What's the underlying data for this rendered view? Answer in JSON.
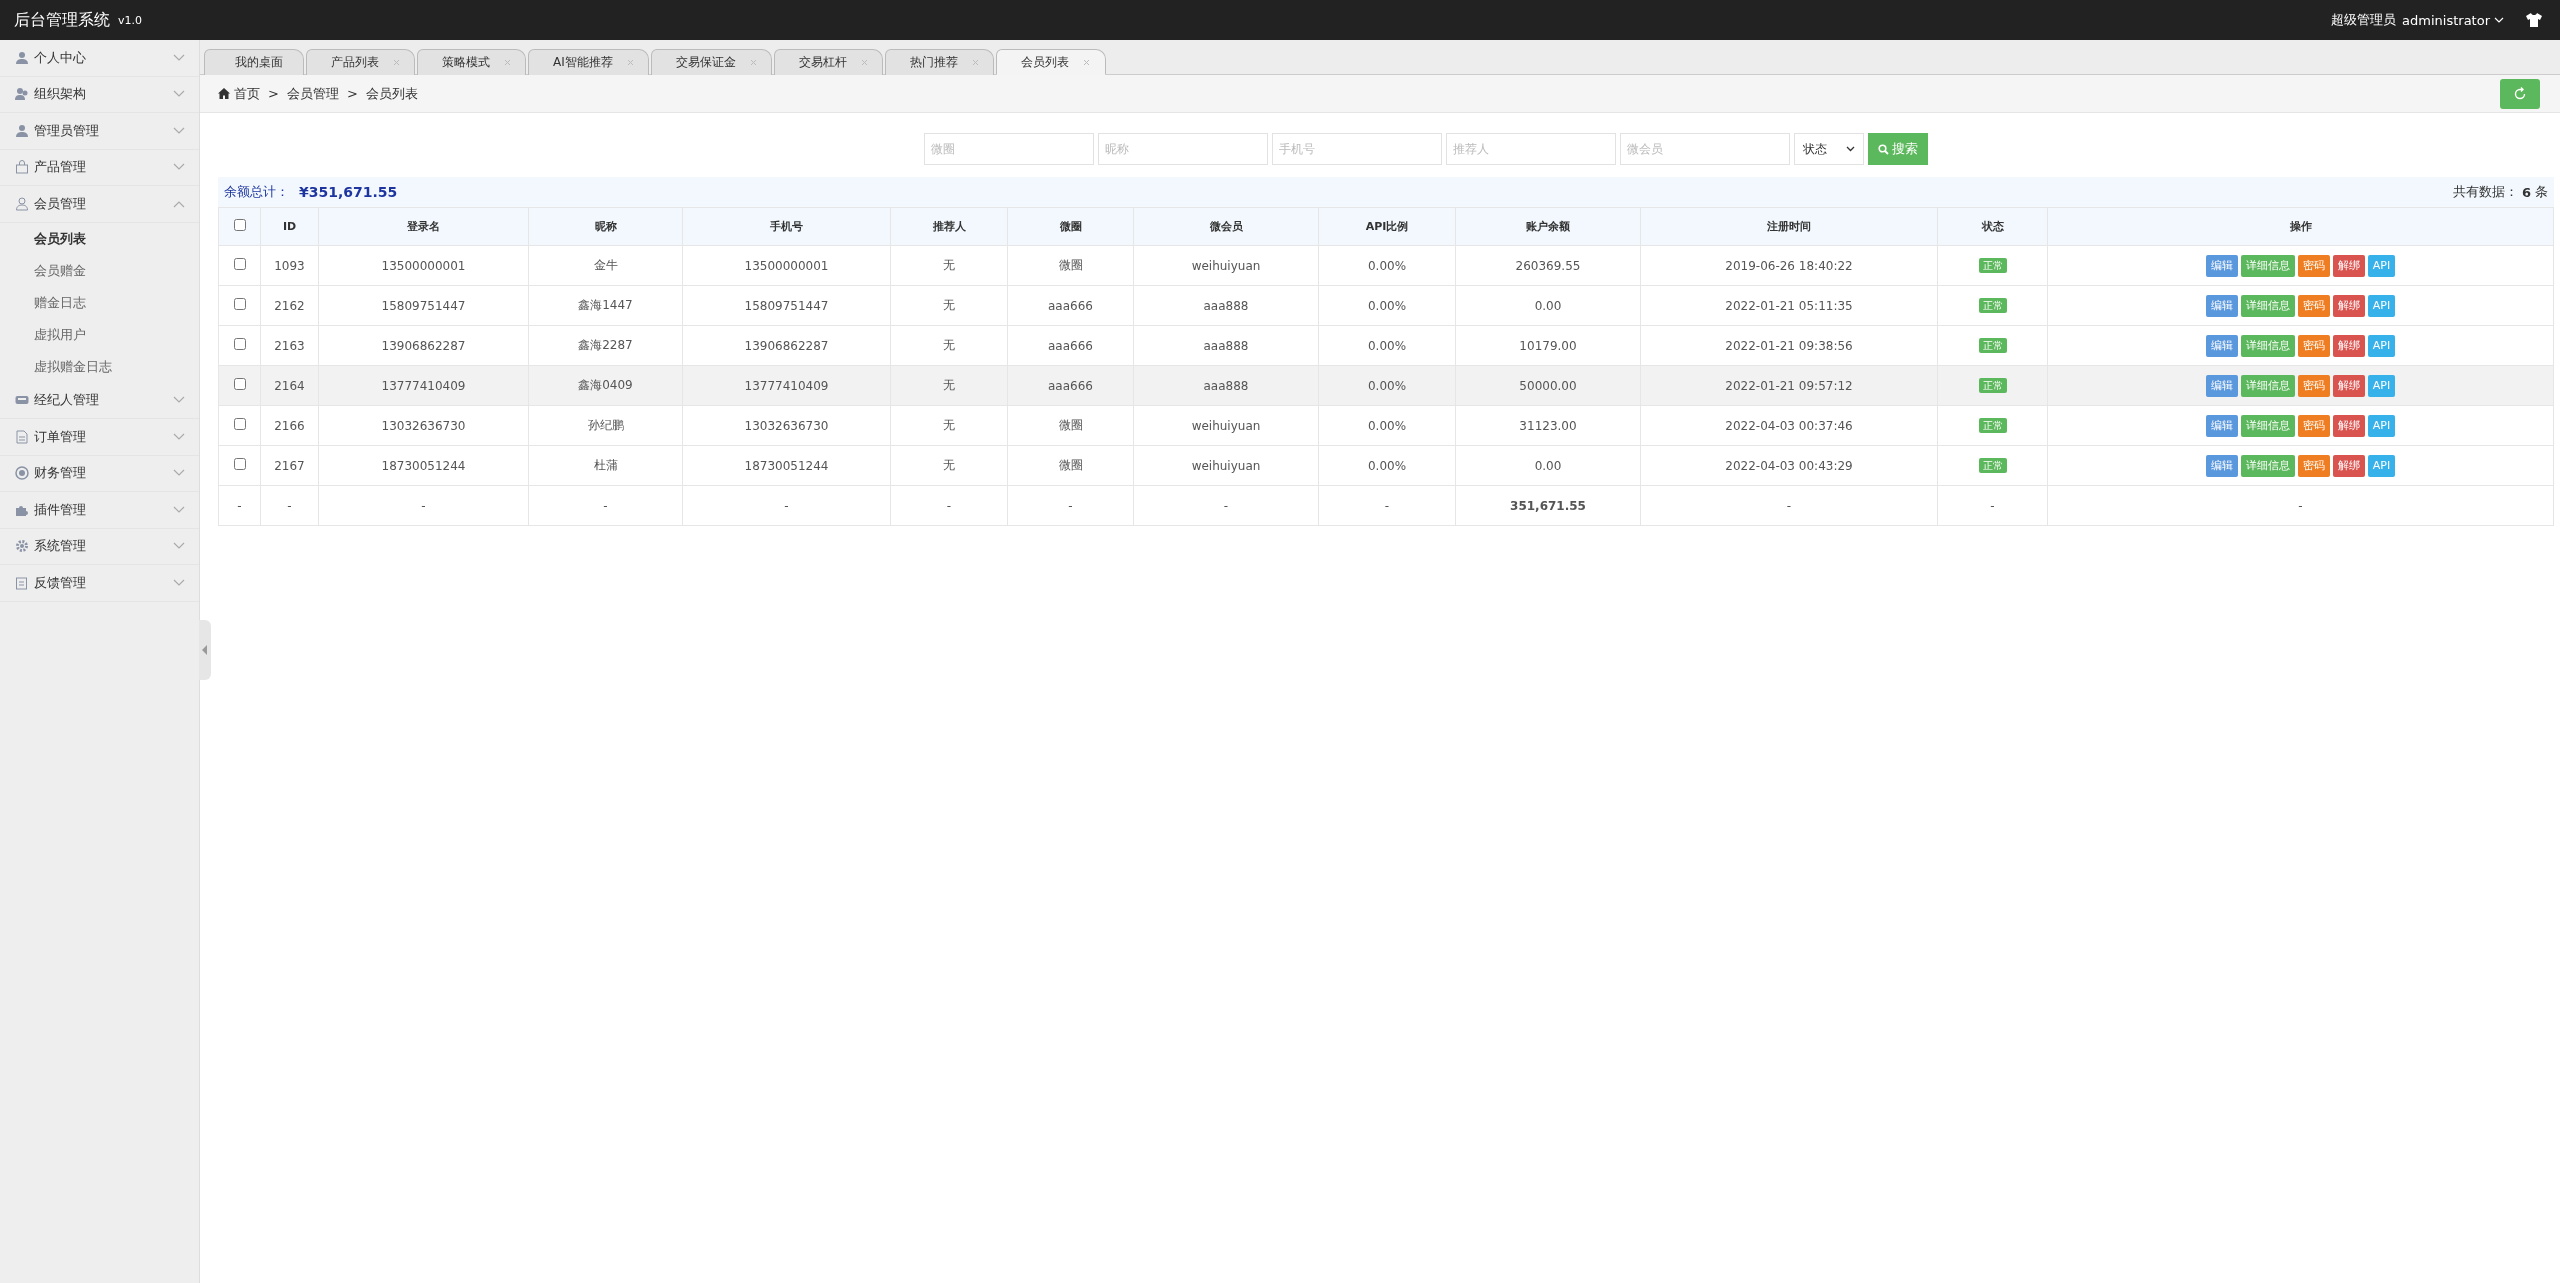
{
  "header": {
    "title": "后台管理系统",
    "version": "v1.0",
    "role": "超级管理员",
    "user": "administrator"
  },
  "sidebar": {
    "items": [
      {
        "label": "个人中心",
        "expanded": false
      },
      {
        "label": "组织架构",
        "expanded": false
      },
      {
        "label": "管理员管理",
        "expanded": false
      },
      {
        "label": "产品管理",
        "expanded": false
      },
      {
        "label": "会员管理",
        "expanded": true,
        "children": [
          {
            "label": "会员列表",
            "selected": true
          },
          {
            "label": "会员赠金",
            "selected": false
          },
          {
            "label": "赠金日志",
            "selected": false
          },
          {
            "label": "虚拟用户",
            "selected": false
          },
          {
            "label": "虚拟赠金日志",
            "selected": false
          }
        ]
      },
      {
        "label": "经纪人管理",
        "expanded": false
      },
      {
        "label": "订单管理",
        "expanded": false
      },
      {
        "label": "财务管理",
        "expanded": false
      },
      {
        "label": "插件管理",
        "expanded": false
      },
      {
        "label": "系统管理",
        "expanded": false
      },
      {
        "label": "反馈管理",
        "expanded": false
      }
    ]
  },
  "tabs": [
    {
      "label": "我的桌面",
      "closable": false,
      "selected": false
    },
    {
      "label": "产品列表",
      "closable": true,
      "selected": false
    },
    {
      "label": "策略模式",
      "closable": true,
      "selected": false
    },
    {
      "label": "AI智能推荐",
      "closable": true,
      "selected": false
    },
    {
      "label": "交易保证金",
      "closable": true,
      "selected": false
    },
    {
      "label": "交易杠杆",
      "closable": true,
      "selected": false
    },
    {
      "label": "热门推荐",
      "closable": true,
      "selected": false
    },
    {
      "label": "会员列表",
      "closable": true,
      "selected": true
    }
  ],
  "breadcrumb": {
    "items": [
      "首页",
      "会员管理",
      "会员列表"
    ],
    "separators": [
      ">",
      ">"
    ]
  },
  "search": {
    "fields": [
      {
        "placeholder": "微圈"
      },
      {
        "placeholder": "昵称"
      },
      {
        "placeholder": "手机号"
      },
      {
        "placeholder": "推荐人"
      },
      {
        "placeholder": "微会员"
      }
    ],
    "status_select": "状态",
    "button": "搜索"
  },
  "summary": {
    "label": "余额总计：",
    "total": "¥351,671.55",
    "count_label": "共有数据：",
    "count": "6",
    "count_unit": "条"
  },
  "table": {
    "select_all_checked": false,
    "columns": [
      "ID",
      "登录名",
      "昵称",
      "手机号",
      "推荐人",
      "微圈",
      "微会员",
      "API比例",
      "账户余额",
      "注册时间",
      "状态",
      "操作"
    ],
    "rows": [
      {
        "checked": false,
        "highlighted": false,
        "cells": [
          "1093",
          "13500000001",
          "金牛",
          "13500000001",
          "无",
          "微圈",
          "weihuiyuan",
          "0.00%",
          "260369.55",
          "2019-06-26 18:40:22"
        ],
        "status": "正常",
        "actions": [
          {
            "label": "编辑",
            "kind": "edit"
          },
          {
            "label": "详细信息",
            "kind": "detail"
          },
          {
            "label": "密码",
            "kind": "password"
          },
          {
            "label": "解绑",
            "kind": "unbind"
          },
          {
            "label": "API",
            "kind": "api"
          }
        ]
      },
      {
        "checked": false,
        "highlighted": false,
        "cells": [
          "2162",
          "15809751447",
          "鑫海1447",
          "15809751447",
          "无",
          "aaa666",
          "aaa888",
          "0.00%",
          "0.00",
          "2022-01-21 05:11:35"
        ],
        "status": "正常",
        "actions": [
          {
            "label": "编辑",
            "kind": "edit"
          },
          {
            "label": "详细信息",
            "kind": "detail"
          },
          {
            "label": "密码",
            "kind": "password"
          },
          {
            "label": "解绑",
            "kind": "unbind"
          },
          {
            "label": "API",
            "kind": "api"
          }
        ]
      },
      {
        "checked": false,
        "highlighted": false,
        "cells": [
          "2163",
          "13906862287",
          "鑫海2287",
          "13906862287",
          "无",
          "aaa666",
          "aaa888",
          "0.00%",
          "10179.00",
          "2022-01-21 09:38:56"
        ],
        "status": "正常",
        "actions": [
          {
            "label": "编辑",
            "kind": "edit"
          },
          {
            "label": "详细信息",
            "kind": "detail"
          },
          {
            "label": "密码",
            "kind": "password"
          },
          {
            "label": "解绑",
            "kind": "unbind"
          },
          {
            "label": "API",
            "kind": "api"
          }
        ]
      },
      {
        "checked": false,
        "highlighted": true,
        "cells": [
          "2164",
          "13777410409",
          "鑫海0409",
          "13777410409",
          "无",
          "aaa666",
          "aaa888",
          "0.00%",
          "50000.00",
          "2022-01-21 09:57:12"
        ],
        "status": "正常",
        "actions": [
          {
            "label": "编辑",
            "kind": "edit"
          },
          {
            "label": "详细信息",
            "kind": "detail"
          },
          {
            "label": "密码",
            "kind": "password"
          },
          {
            "label": "解绑",
            "kind": "unbind"
          },
          {
            "label": "API",
            "kind": "api"
          }
        ]
      },
      {
        "checked": false,
        "highlighted": false,
        "cells": [
          "2166",
          "13032636730",
          "孙纪鹏",
          "13032636730",
          "无",
          "微圈",
          "weihuiyuan",
          "0.00%",
          "31123.00",
          "2022-04-03 00:37:46"
        ],
        "status": "正常",
        "actions": [
          {
            "label": "编辑",
            "kind": "edit"
          },
          {
            "label": "详细信息",
            "kind": "detail"
          },
          {
            "label": "密码",
            "kind": "password"
          },
          {
            "label": "解绑",
            "kind": "unbind"
          },
          {
            "label": "API",
            "kind": "api"
          }
        ]
      },
      {
        "checked": false,
        "highlighted": false,
        "cells": [
          "2167",
          "18730051244",
          "杜蒲",
          "18730051244",
          "无",
          "微圈",
          "weihuiyuan",
          "0.00%",
          "0.00",
          "2022-04-03 00:43:29"
        ],
        "status": "正常",
        "actions": [
          {
            "label": "编辑",
            "kind": "edit"
          },
          {
            "label": "详细信息",
            "kind": "detail"
          },
          {
            "label": "密码",
            "kind": "password"
          },
          {
            "label": "解绑",
            "kind": "unbind"
          },
          {
            "label": "API",
            "kind": "api"
          }
        ]
      }
    ],
    "footer": [
      "-",
      "-",
      "-",
      "-",
      "-",
      "-",
      "-",
      "-",
      "-",
      "351,671.55",
      "-",
      "-",
      "-"
    ]
  }
}
